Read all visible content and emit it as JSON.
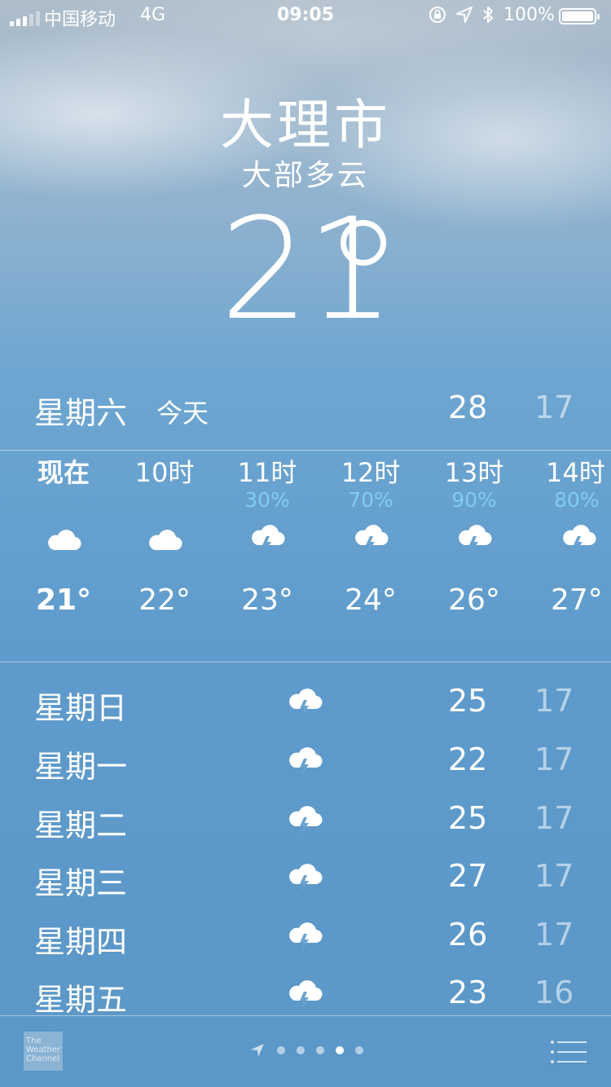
{
  "status_bar": {
    "carrier": "中国移动",
    "network": "4G",
    "time": "09:05",
    "battery": "100%",
    "icons": [
      "orientation-lock-icon",
      "location-arrow-icon",
      "bluetooth-icon",
      "battery-icon"
    ]
  },
  "location": {
    "city": "大理市",
    "condition": "大部多云",
    "temperature": "21"
  },
  "today": {
    "day": "星期六",
    "label": "今天",
    "high": "28",
    "low": "17"
  },
  "hourly": [
    {
      "time": "现在",
      "pop": "",
      "icon": "cloud-icon",
      "temp": "21°"
    },
    {
      "time": "10时",
      "pop": "",
      "icon": "cloud-icon",
      "temp": "22°"
    },
    {
      "time": "11时",
      "pop": "30%",
      "icon": "thunderstorm-icon",
      "temp": "23°"
    },
    {
      "time": "12时",
      "pop": "70%",
      "icon": "thunderstorm-icon",
      "temp": "24°"
    },
    {
      "time": "13时",
      "pop": "90%",
      "icon": "thunderstorm-icon",
      "temp": "26°"
    },
    {
      "time": "14时",
      "pop": "80%",
      "icon": "thunderstorm-icon",
      "temp": "27°"
    }
  ],
  "daily": [
    {
      "day": "星期日",
      "icon": "thunderstorm-icon",
      "high": "25",
      "low": "17"
    },
    {
      "day": "星期一",
      "icon": "thunderstorm-icon",
      "high": "22",
      "low": "17"
    },
    {
      "day": "星期二",
      "icon": "thunderstorm-icon",
      "high": "25",
      "low": "17"
    },
    {
      "day": "星期三",
      "icon": "thunderstorm-icon",
      "high": "27",
      "low": "17"
    },
    {
      "day": "星期四",
      "icon": "thunderstorm-icon",
      "high": "26",
      "low": "17"
    },
    {
      "day": "星期五",
      "icon": "thunderstorm-icon",
      "high": "23",
      "low": "16"
    }
  ],
  "bottom_bar": {
    "logo_text": [
      "The",
      "Weather",
      "Channel"
    ],
    "page_count": 5,
    "active_page": 4
  },
  "colors": {
    "precip": "#82ccf3",
    "sky_top": "#aebdca",
    "sky_bottom": "#5b97c7"
  }
}
